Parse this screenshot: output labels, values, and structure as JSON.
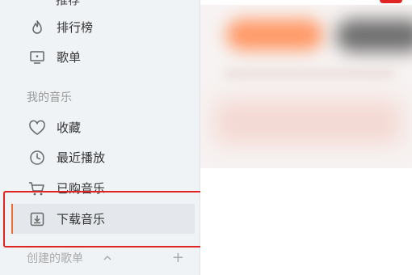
{
  "sidebar": {
    "top_item": {
      "label": "推荐",
      "icon": "podcast-icon"
    },
    "items": [
      {
        "label": "排行榜",
        "icon": "fire-icon"
      },
      {
        "label": "歌单",
        "icon": "monitor-icon"
      }
    ],
    "my_music": {
      "title": "我的音乐",
      "items": [
        {
          "label": "收藏",
          "icon": "heart-icon"
        },
        {
          "label": "最近播放",
          "icon": "clock-icon"
        },
        {
          "label": "已购音乐",
          "icon": "cart-icon"
        },
        {
          "label": "下载音乐",
          "icon": "download-icon",
          "active": true
        }
      ]
    },
    "created_playlists": {
      "title": "创建的歌单",
      "collapse_icon": "chevron-up-icon",
      "add_label": "+"
    }
  },
  "colors": {
    "accent": "#ec6c33",
    "highlight": "#e02424",
    "sidebar_bg": "#f0f3f6"
  }
}
